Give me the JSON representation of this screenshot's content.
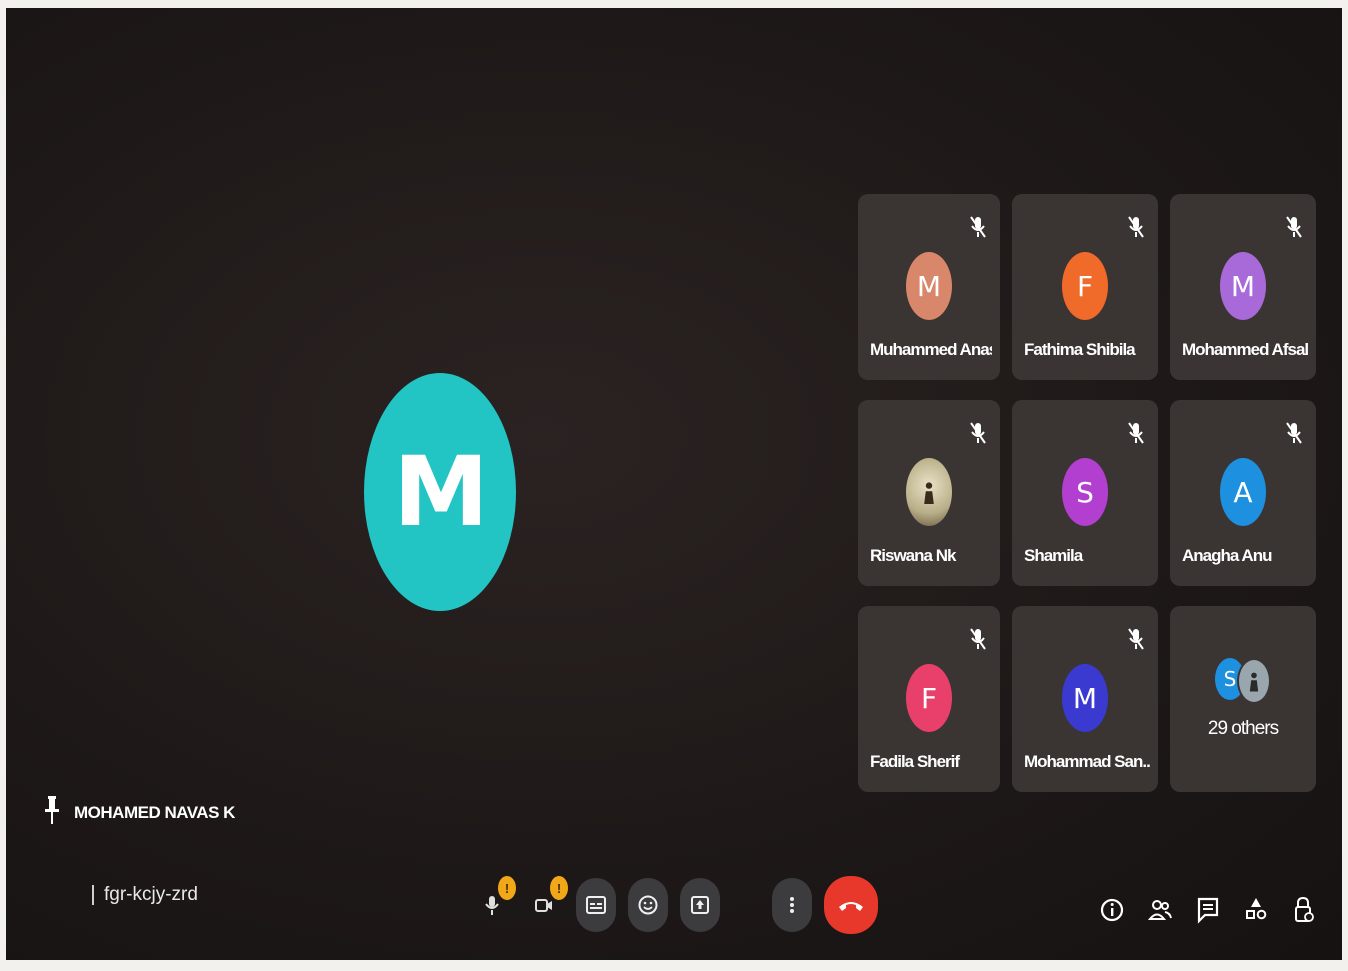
{
  "presenter": {
    "initial": "M",
    "color": "#22c4c4",
    "pinned_name": "MOHAMED NAVAS K"
  },
  "meeting": {
    "code": "fgr-kcjy-zrd"
  },
  "participants": [
    {
      "name": "Muhammed Anas",
      "initial": "M",
      "color": "#d9876a",
      "muted": true
    },
    {
      "name": "Fathima Shibila",
      "initial": "F",
      "color": "#f06a2a",
      "muted": true
    },
    {
      "name": "Mohammed Afsal",
      "initial": "M",
      "color": "#a86ad8",
      "muted": true
    },
    {
      "name": "Riswana Nk",
      "initial": "",
      "color": "#c8c2a8",
      "muted": true
    },
    {
      "name": "Shamila",
      "initial": "S",
      "color": "#b23fd0",
      "muted": true
    },
    {
      "name": "Anagha Anu",
      "initial": "A",
      "color": "#1e90e0",
      "muted": true
    },
    {
      "name": "Fadila Sherif",
      "initial": "F",
      "color": "#e8406a",
      "muted": true
    },
    {
      "name": "Mohammad San...",
      "initial": "M",
      "color": "#3a3ad0",
      "muted": true
    }
  ],
  "others": {
    "label": "29 others",
    "initial": "S",
    "color": "#1e90e0"
  },
  "controls": {
    "mic_icon": "mic-icon",
    "camera_icon": "camera-icon",
    "captions_icon": "captions-icon",
    "emoji_icon": "emoji-icon",
    "present_icon": "present-icon",
    "more_icon": "more-options-icon",
    "end_call_color": "#e8382c",
    "warn_mark": "!"
  },
  "side_icons": [
    "info-icon",
    "people-icon",
    "chat-icon",
    "activities-icon",
    "host-controls-icon"
  ]
}
